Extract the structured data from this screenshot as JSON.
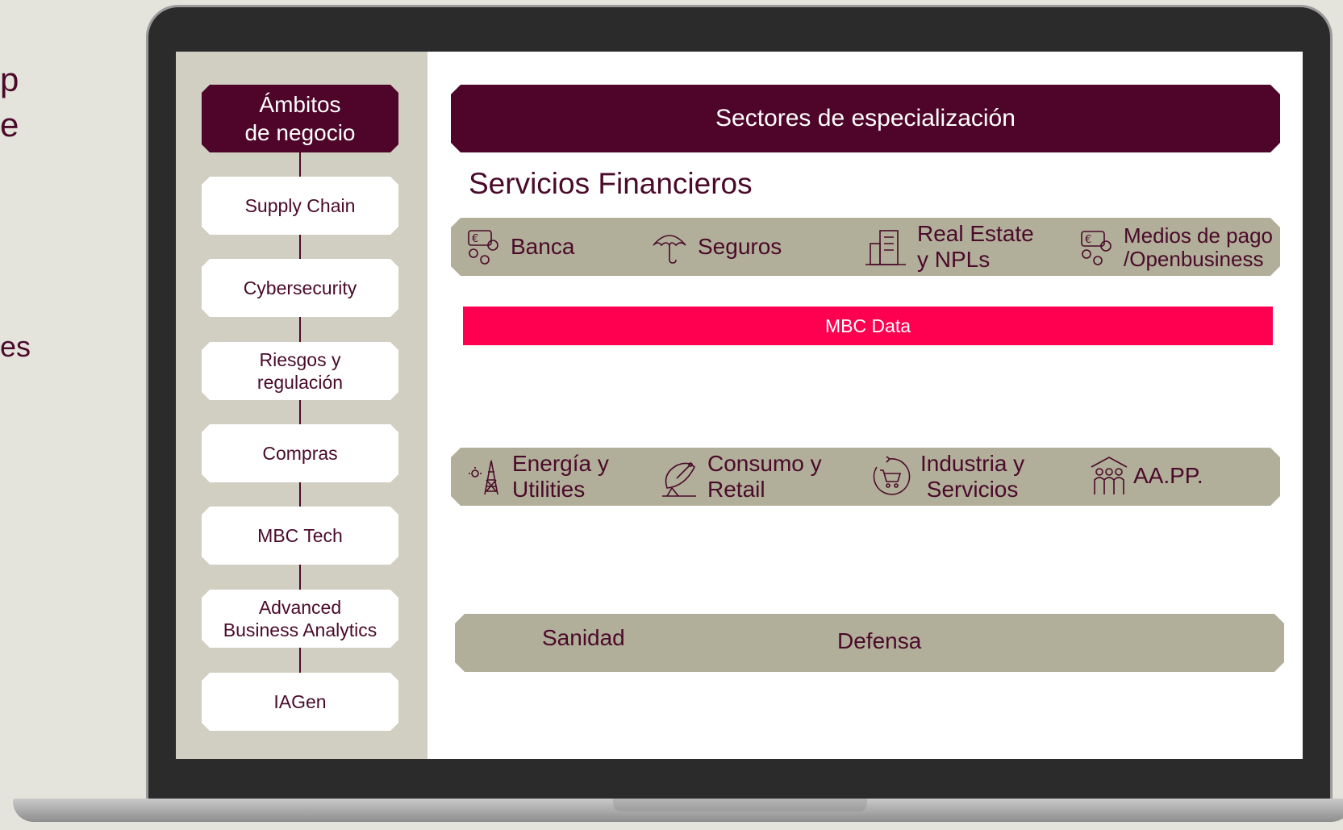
{
  "edge_texts": [
    "p",
    "e",
    "es"
  ],
  "sidebar": {
    "title": "Ámbitos\nde negocio",
    "items": [
      {
        "label": "Supply Chain"
      },
      {
        "label": "Cybersecurity"
      },
      {
        "label": "Riesgos y\nregulación"
      },
      {
        "label": "Compras"
      },
      {
        "label": "MBC Tech"
      },
      {
        "label": "Advanced\nBusiness Analytics"
      },
      {
        "label": "IAGen"
      }
    ]
  },
  "main": {
    "header": "Sectores de especialización",
    "financial": {
      "title": "Servicios Financieros",
      "items": [
        {
          "label": "Banca",
          "icon": "currency-icon"
        },
        {
          "label": "Seguros",
          "icon": "umbrella-icon"
        },
        {
          "label": "Real Estate\ny NPLs",
          "icon": "building-icon"
        },
        {
          "label": "Medios de pago\n/Openbusiness",
          "icon": "currency-icon"
        }
      ]
    },
    "mbc_data": "MBC Data",
    "industry": {
      "items": [
        {
          "label": "Energía y\nUtilities",
          "icon": "power-tower-icon"
        },
        {
          "label": "Consumo y\nRetail",
          "icon": "satellite-dish-icon"
        },
        {
          "label": "Industria y\nServicios",
          "icon": "cart-cycle-icon"
        },
        {
          "label": "AA.PP.",
          "icon": "public-building-icon"
        }
      ]
    },
    "health_defense": {
      "items": [
        {
          "label": "Sanidad"
        },
        {
          "label": "Defensa"
        }
      ]
    }
  },
  "colors": {
    "brand": "#4e0529",
    "accent": "#ff0050",
    "band": "#b1ae99",
    "sidebar_bg": "#d1cfc2"
  }
}
